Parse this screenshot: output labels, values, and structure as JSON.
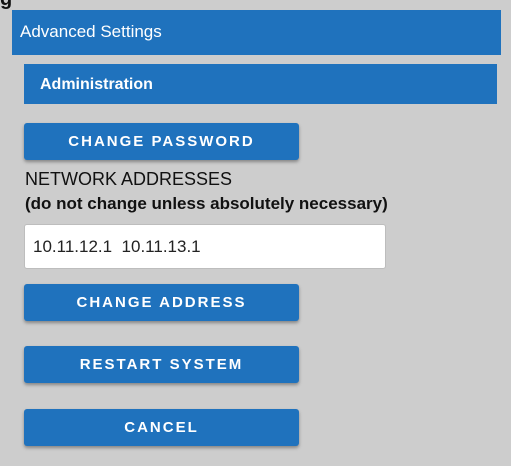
{
  "window": {
    "title": "Advanced Settings"
  },
  "section": {
    "title": "Administration"
  },
  "buttons": {
    "change_password": "CHANGE PASSWORD",
    "change_address": "CHANGE ADDRESS",
    "restart_system": "RESTART SYSTEM",
    "cancel": "CANCEL"
  },
  "network": {
    "heading": "NETWORK ADDRESSES",
    "warning": "(do not change unless absolutely necessary)",
    "addresses_value": "10.11.12.1  10.11.13.1"
  },
  "colors": {
    "accent": "#1f72bd",
    "background": "#cdcdcd",
    "button_text": "#ffffff"
  }
}
